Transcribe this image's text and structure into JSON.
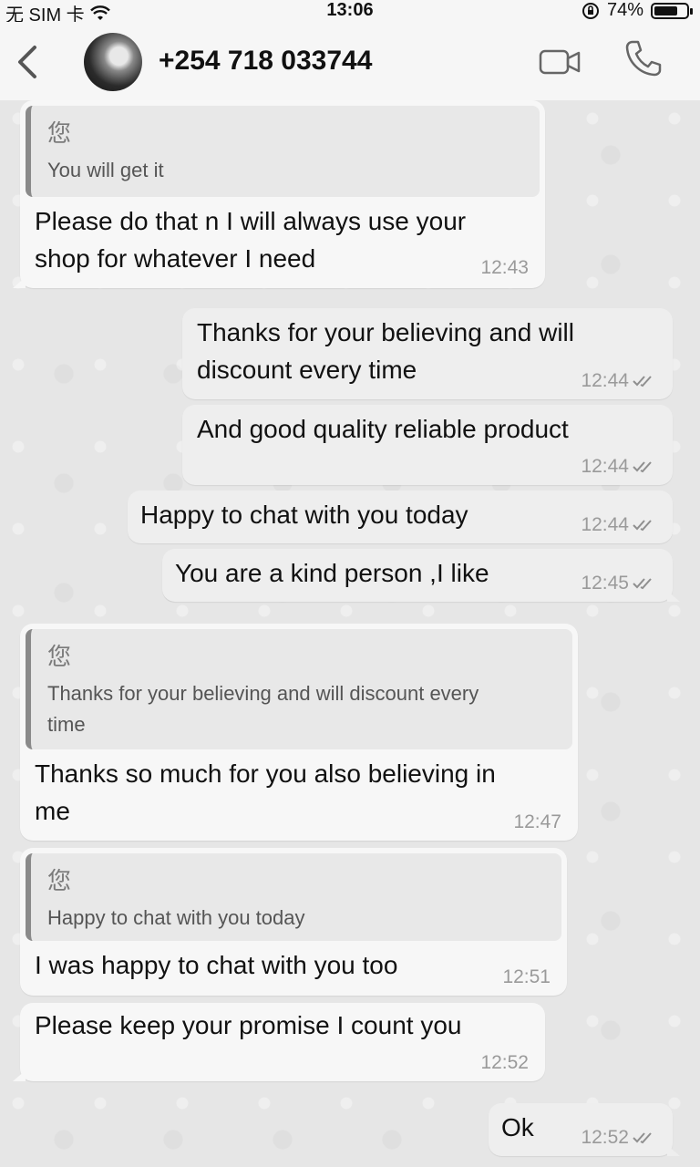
{
  "status": {
    "carrier": "无 SIM 卡",
    "time": "13:06",
    "battery": "74%",
    "battery_level": 0.74
  },
  "header": {
    "contact_name": "+254 718 033744"
  },
  "icons": {
    "back": "chevron-left-icon",
    "video": "video-camera-icon",
    "call": "phone-icon",
    "wifi": "wifi-icon",
    "lock_rotation": "orientation-lock-icon",
    "read_receipt": "double-check-icon"
  },
  "messages": [
    {
      "dir": "in",
      "quote": {
        "name": "您",
        "text": "You will get it"
      },
      "text_lines": [
        "Please do that n I will always use your",
        "shop for whatever I need"
      ],
      "time": "12:43"
    },
    {
      "dir": "out",
      "text_lines": [
        "Thanks for your believing and will",
        "discount every time"
      ],
      "time": "12:44"
    },
    {
      "dir": "out",
      "text_lines": [
        "And good quality reliable product"
      ],
      "time": "12:44"
    },
    {
      "dir": "out",
      "text_lines": [
        "Happy to chat with you today"
      ],
      "time": "12:44"
    },
    {
      "dir": "out",
      "text_lines": [
        "You are a kind person ,I like"
      ],
      "time": "12:45"
    },
    {
      "dir": "in",
      "quote": {
        "name": "您",
        "text_lines": [
          "Thanks for your believing and will discount every",
          "time"
        ]
      },
      "text_lines": [
        "Thanks so much for you also believing in",
        "me"
      ],
      "time": "12:47"
    },
    {
      "dir": "in",
      "quote": {
        "name": "您",
        "text": "Happy to chat with you today"
      },
      "text_lines": [
        "I was happy to chat with you too"
      ],
      "time": "12:51"
    },
    {
      "dir": "in",
      "text_lines": [
        "Please keep your promise I count you"
      ],
      "time": "12:52"
    },
    {
      "dir": "out",
      "text_lines": [
        "Ok"
      ],
      "time": "12:52"
    }
  ],
  "colors": {
    "incoming_bubble": "#f7f7f7",
    "outgoing_bubble": "#eeeeee",
    "quote_bar": "#8a8a8a",
    "tick": "#9a9a9a"
  }
}
